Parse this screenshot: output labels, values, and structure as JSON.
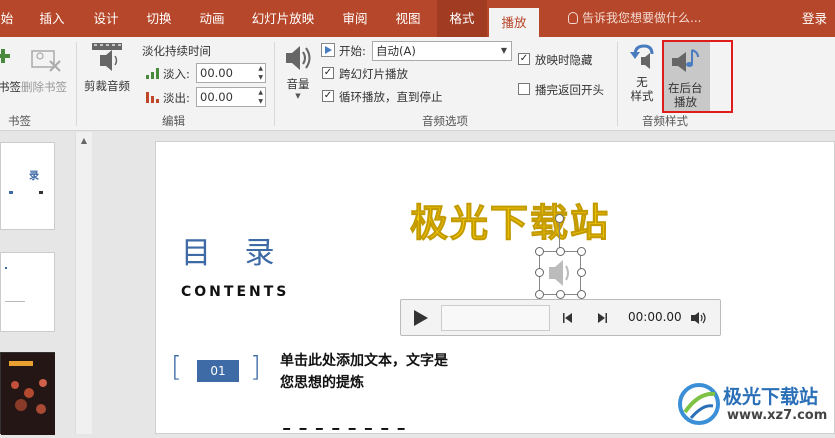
{
  "tabs": [
    {
      "label": "始"
    },
    {
      "label": "插入"
    },
    {
      "label": "设计"
    },
    {
      "label": "切换"
    },
    {
      "label": "动画"
    },
    {
      "label": "幻灯片放映"
    },
    {
      "label": "审阅"
    },
    {
      "label": "视图"
    },
    {
      "label": "格式"
    },
    {
      "label": "播放"
    }
  ],
  "tell_me": "告诉我您想要做什么...",
  "sign_in": "登录",
  "ribbon": {
    "bookmarks": {
      "add_label": "书签",
      "remove_label": "删除书签",
      "group_label": "书签"
    },
    "edit": {
      "trim_label": "剪裁音频",
      "fade_title": "淡化持续时间",
      "fade_in_label": "淡入:",
      "fade_in_value": "00.00",
      "fade_out_label": "淡出:",
      "fade_out_value": "00.00",
      "group_label": "编辑"
    },
    "audio_options": {
      "volume_label": "音量",
      "start_label": "开始:",
      "start_value": "自动(A)",
      "cross_slides_label": "跨幻灯片播放",
      "loop_label": "循环播放，直到停止",
      "hide_label": "放映时隐藏",
      "rewind_label": "播完返回开头",
      "group_label": "音频选项"
    },
    "audio_styles": {
      "no_style_label_1": "无",
      "no_style_label_2": "样式",
      "bg_play_label_1": "在后台",
      "bg_play_label_2": "播放",
      "group_label": "音频样式"
    }
  },
  "slide": {
    "title": "目 录",
    "subtitle": "CONTENTS",
    "watermark": "极光下载站",
    "item1_number": "01",
    "item1_text_line1": "单击此处添加文本，文字是",
    "item1_text_line2": "您思想的提炼"
  },
  "player": {
    "time": "00:00.00"
  },
  "thumbnails": {
    "t1_text": "录"
  },
  "site_logo": {
    "name": "极光下载站",
    "url": "www.xz7.com"
  },
  "colors": {
    "accent": "#b7472a",
    "slide_blue": "#3e6aa6",
    "watermark": "#ffd400",
    "highlight_box": "#e01b1b"
  }
}
